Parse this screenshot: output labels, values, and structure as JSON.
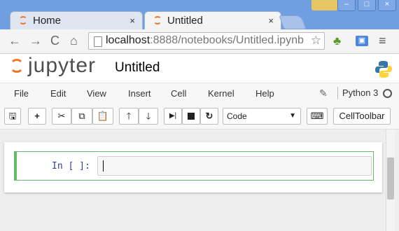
{
  "browser": {
    "tabs": [
      {
        "title": "Home",
        "close": "×",
        "active": false
      },
      {
        "title": "Untitled",
        "close": "×",
        "active": true
      }
    ],
    "url_host": "localhost",
    "url_rest": ":8888/notebooks/Untitled.ipynb"
  },
  "notebook": {
    "logo_text": "jupyter",
    "title": "Untitled",
    "menu": [
      "File",
      "Edit",
      "View",
      "Insert",
      "Cell",
      "Kernel",
      "Help"
    ],
    "kernel_name": "Python 3",
    "cell_type": "Code",
    "celltoolbar_label": "CellToolbar",
    "cell_prompt": "In [ ]:"
  },
  "icons": {
    "save": "floppy-icon",
    "add": "plus-icon",
    "cut": "scissors-icon",
    "copy": "copy-icon",
    "paste": "paste-icon",
    "up": "arrow-up-icon",
    "down": "arrow-down-icon",
    "run": "run-icon",
    "stop": "stop-icon",
    "restart": "restart-icon",
    "keyboard": "keyboard-icon"
  },
  "colors": {
    "accent": "#f37726",
    "cell_border": "#66bb6a",
    "prompt": "#303f9f",
    "chrome": "#6f9fe0"
  }
}
